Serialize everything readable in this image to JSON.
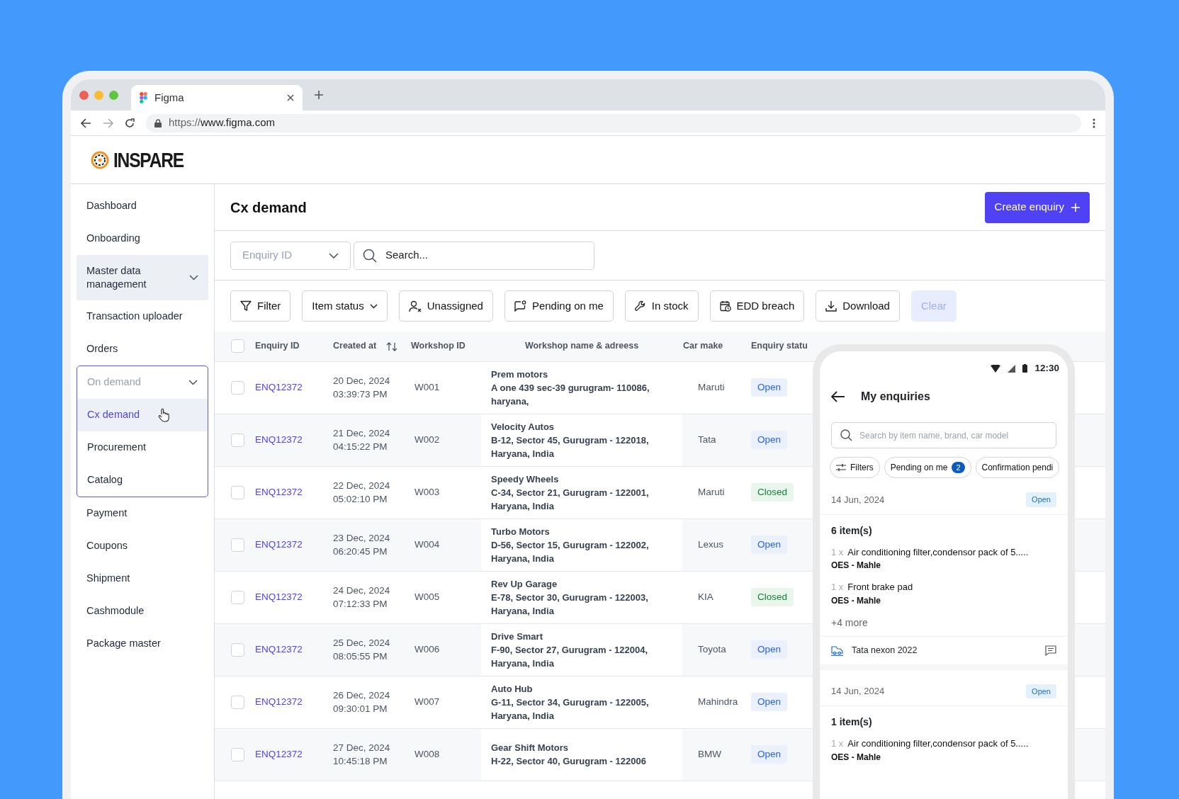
{
  "browser": {
    "tab_title": "Figma",
    "url_scheme": "https://",
    "url_host": "www.figma.com"
  },
  "brand": {
    "name": "INSPARE"
  },
  "sidebar": {
    "items": [
      {
        "label": "Dashboard"
      },
      {
        "label": "Onboarding"
      },
      {
        "label": "Master data management",
        "hovered": true,
        "expanded": false
      },
      {
        "label": "Transaction uploader"
      },
      {
        "label": "Orders"
      },
      {
        "label": "On demand",
        "expanded": true,
        "children": [
          {
            "label": "Cx demand",
            "selected": true
          },
          {
            "label": "Procurement",
            "selected": false
          },
          {
            "label": "Catalog",
            "selected": false
          }
        ]
      },
      {
        "label": "Payment"
      },
      {
        "label": "Coupons"
      },
      {
        "label": "Shipment"
      },
      {
        "label": "Cashmodule"
      },
      {
        "label": "Package master"
      }
    ]
  },
  "page": {
    "title": "Cx demand",
    "create_button": "Create enquiry",
    "id_select": {
      "placeholder": "Enquiry ID"
    },
    "search": {
      "placeholder": "Search..."
    }
  },
  "toolbar": [
    {
      "label": "Filter",
      "disabled": false,
      "caret": false
    },
    {
      "label": "Item status",
      "disabled": false,
      "caret": true
    },
    {
      "label": "Unassigned",
      "disabled": false,
      "caret": false
    },
    {
      "label": "Pending on me",
      "disabled": false,
      "caret": false
    },
    {
      "label": "In stock",
      "disabled": false,
      "caret": false
    },
    {
      "label": "EDD breach",
      "disabled": false,
      "caret": false
    },
    {
      "label": "Download",
      "disabled": false,
      "caret": false
    },
    {
      "label": "Clear",
      "disabled": true,
      "caret": false
    }
  ],
  "table": {
    "all_checked": false,
    "columns": [
      "Enquiry ID",
      "Created at",
      "Workshop ID",
      "Workshop name & adreess",
      "Car make",
      "Enquiry statu"
    ],
    "rows": [
      {
        "checked": false,
        "id": "ENQ12372",
        "date": "20 Dec, 2024",
        "time": "03:39:73 PM",
        "workshop_id": "W001",
        "workshop_name": "Prem motors",
        "address": [
          "A one 439 sec-39 gurugram- 110086,",
          "haryana,"
        ],
        "car_make": "Maruti",
        "status": {
          "label": "Open",
          "kind": "open"
        }
      },
      {
        "checked": false,
        "id": "ENQ12372",
        "date": "21 Dec, 2024",
        "time": "04:15:22 PM",
        "workshop_id": "W002",
        "workshop_name": "Velocity Autos",
        "address": [
          "B-12, Sector 45, Gurugram - 122018,",
          "Haryana, India"
        ],
        "car_make": "Tata",
        "status": {
          "label": "Open",
          "kind": "open"
        }
      },
      {
        "checked": false,
        "id": "ENQ12372",
        "date": "22 Dec, 2024",
        "time": "05:02:10 PM",
        "workshop_id": "W003",
        "workshop_name": "Speedy Wheels",
        "address": [
          "C-34, Sector 21, Gurugram - 122001,",
          "Haryana, India"
        ],
        "car_make": "Maruti",
        "status": {
          "label": "Closed",
          "kind": "closed"
        }
      },
      {
        "checked": false,
        "id": "ENQ12372",
        "date": "23 Dec, 2024",
        "time": "06:20:45 PM",
        "workshop_id": "W004",
        "workshop_name": "Turbo Motors",
        "address": [
          "D-56, Sector 15, Gurugram - 122002,",
          "Haryana, India"
        ],
        "car_make": "Lexus",
        "status": {
          "label": "Open",
          "kind": "open"
        }
      },
      {
        "checked": false,
        "id": "ENQ12372",
        "date": "24 Dec, 2024",
        "time": "07:12:33 PM",
        "workshop_id": "W005",
        "workshop_name": "Rev Up Garage",
        "address": [
          "E-78, Sector 30, Gurugram - 122003,",
          "Haryana, India"
        ],
        "car_make": "KIA",
        "status": {
          "label": "Closed",
          "kind": "closed"
        }
      },
      {
        "checked": false,
        "id": "ENQ12372",
        "date": "25 Dec, 2024",
        "time": "08:05:55 PM",
        "workshop_id": "W006",
        "workshop_name": "Drive Smart",
        "address": [
          "F-90, Sector 27, Gurugram - 122004,",
          "Haryana, India"
        ],
        "car_make": "Toyota",
        "status": {
          "label": "Open",
          "kind": "open"
        }
      },
      {
        "checked": false,
        "id": "ENQ12372",
        "date": "26 Dec, 2024",
        "time": "09:30:01 PM",
        "workshop_id": "W007",
        "workshop_name": "Auto Hub",
        "address": [
          "G-11, Sector 34, Gurugram - 122005,",
          "Haryana, India"
        ],
        "car_make": "Mahindra",
        "status": {
          "label": "Open",
          "kind": "open"
        }
      },
      {
        "checked": false,
        "id": "ENQ12372",
        "date": "27 Dec, 2024",
        "time": "10:45:18 PM",
        "workshop_id": "W008",
        "workshop_name": "Gear Shift Motors",
        "address": [
          "H-22, Sector 40, Gurugram - 122006"
        ],
        "car_make": "BMW",
        "status": {
          "label": "Open",
          "kind": "open"
        }
      }
    ]
  },
  "phone": {
    "time": "12:30",
    "title": "My enquiries",
    "search": {
      "placeholder": "Search by item name, brand, car model"
    },
    "chips": [
      {
        "label": "Filters"
      },
      {
        "label": "Pending on me",
        "count": "2"
      },
      {
        "label": "Confirmation pendi"
      }
    ],
    "cards": [
      {
        "date": "14 Jun, 2024",
        "status": "Open",
        "count": "6 item(s)",
        "items": [
          {
            "qty": "1 x",
            "name": "Air conditioning filter,condensor pack of 5.....",
            "brand": "OES - Mahle"
          },
          {
            "qty": "1 x",
            "name": "Front brake pad",
            "brand": "OES - Mahle"
          }
        ],
        "more": "+4 more",
        "car": "Tata nexon 2022"
      },
      {
        "date": "14 Jun, 2024",
        "status": "Open",
        "count": "1 item(s)",
        "items": [
          {
            "qty": "1 x",
            "name": "Air conditioning filter,condensor pack of 5.....",
            "brand": "OES - Mahle"
          }
        ]
      }
    ]
  }
}
